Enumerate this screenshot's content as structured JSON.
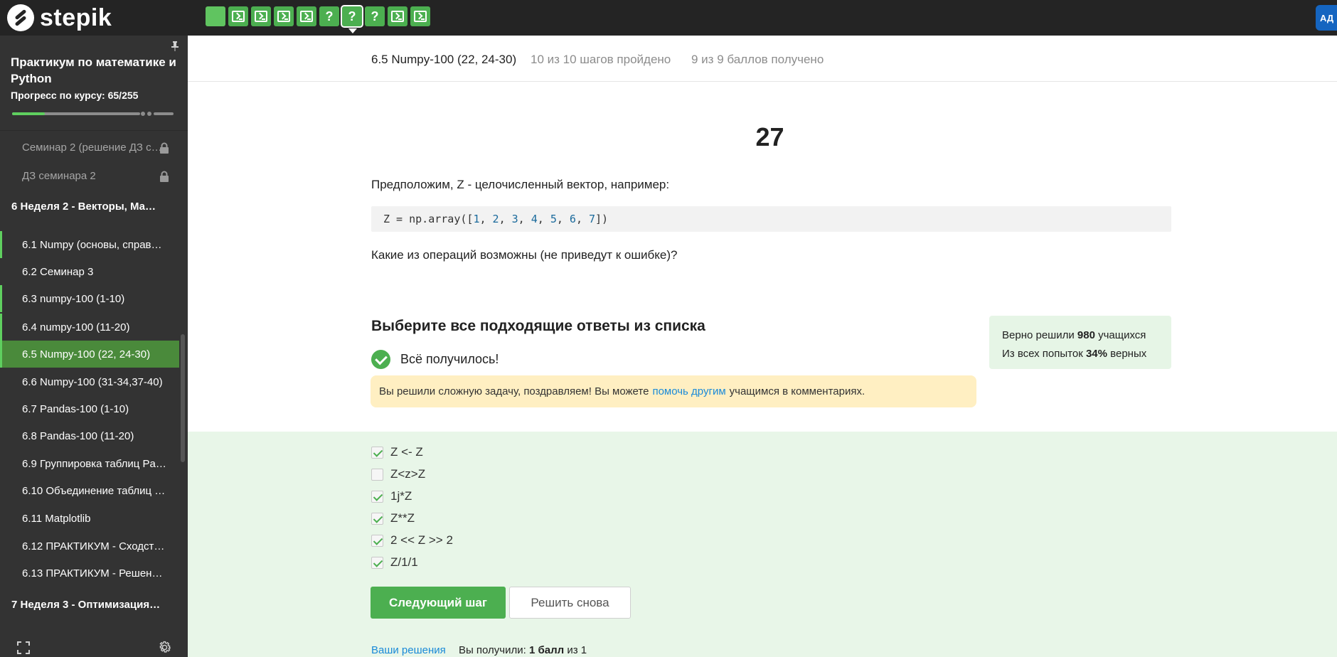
{
  "brand": {
    "name": "stepik"
  },
  "user": {
    "initials": "АД"
  },
  "step_nav": [
    {
      "kind": "empty"
    },
    {
      "kind": "code"
    },
    {
      "kind": "code"
    },
    {
      "kind": "code"
    },
    {
      "kind": "code"
    },
    {
      "kind": "quiz",
      "label": "?"
    },
    {
      "kind": "quiz",
      "label": "?",
      "current": true
    },
    {
      "kind": "quiz",
      "label": "?"
    },
    {
      "kind": "code"
    },
    {
      "kind": "code"
    }
  ],
  "sidebar": {
    "course_title": "Практикум по математике и Python",
    "progress_label": "Прогресс по курсу:  65/255",
    "progress_fraction": 0.255,
    "items": [
      {
        "type": "lesson",
        "label": "Семинар 2 (решение ДЗ с…",
        "state": "muted",
        "locked": true
      },
      {
        "type": "lesson",
        "label": "ДЗ семинара 2",
        "state": "muted",
        "locked": true
      },
      {
        "type": "module",
        "label": "6  Неделя 2 - Векторы, Ма…"
      },
      {
        "type": "lesson",
        "label": "6.1  Numpy (основы, справ…",
        "state": "done"
      },
      {
        "type": "lesson",
        "label": "6.2  Семинар 3",
        "state": "plain"
      },
      {
        "type": "lesson",
        "label": "6.3  numpy-100 (1-10)",
        "state": "done"
      },
      {
        "type": "lesson",
        "label": "6.4  numpy-100 (11-20)",
        "state": "done"
      },
      {
        "type": "lesson",
        "label": "6.5  Numpy-100 (22, 24-30)",
        "state": "active"
      },
      {
        "type": "lesson",
        "label": "6.6  Numpy-100 (31-34,37-40)",
        "state": "plain"
      },
      {
        "type": "lesson",
        "label": "6.7  Pandas-100 (1-10)",
        "state": "plain"
      },
      {
        "type": "lesson",
        "label": "6.8  Pandas-100 (11-20)",
        "state": "plain"
      },
      {
        "type": "lesson",
        "label": "6.9  Группировка таблиц Pa…",
        "state": "plain"
      },
      {
        "type": "lesson",
        "label": "6.10  Объединение таблиц …",
        "state": "plain"
      },
      {
        "type": "lesson",
        "label": "6.11  Matplotlib",
        "state": "plain"
      },
      {
        "type": "lesson",
        "label": "6.12  ПРАКТИКУМ - Сходст…",
        "state": "plain"
      },
      {
        "type": "lesson",
        "label": "6.13  ПРАКТИКУМ - Решени…",
        "state": "plain"
      },
      {
        "type": "module",
        "label": "7  Неделя 3 - Оптимизация…"
      }
    ]
  },
  "lesson_header": {
    "title": "6.5 Numpy-100 (22, 24-30)",
    "steps_status": "10 из 10 шагов пройдено",
    "score_status": "9 из 9 баллов  получено"
  },
  "step": {
    "number": "27",
    "prompt_1": "Предположим, Z - целочисленный вектор, например:",
    "code": {
      "prefix": "Z = np.array([",
      "numbers": [
        "1",
        "2",
        "3",
        "4",
        "5",
        "6",
        "7"
      ],
      "suffix": "])"
    },
    "prompt_2": "Какие из операций возможны (не приведут к ошибке)?"
  },
  "quiz": {
    "title": "Выберите все подходящие ответы из списка",
    "success_text": "Всё получилось!",
    "hint_before": "Вы решили сложную задачу, поздравляем! Вы можете",
    "hint_link": "помочь другим",
    "hint_after": "учащимся в комментариях.",
    "options": [
      {
        "label": "Z <- Z",
        "checked": true
      },
      {
        "label": "Z<z>Z",
        "checked": false
      },
      {
        "label": "1j*Z",
        "checked": true
      },
      {
        "label": "Z**Z",
        "checked": true
      },
      {
        "label": "2 << Z >> 2",
        "checked": true
      },
      {
        "label": "Z/1/1",
        "checked": true
      }
    ],
    "next_button": "Следующий шаг",
    "retry_button": "Решить снова"
  },
  "stats": {
    "solved_prefix": "Верно решили",
    "solved_count": "980",
    "solved_suffix": "учащихся",
    "attempts_prefix": "Из всех попыток",
    "attempts_percent": "34%",
    "attempts_suffix": "верных"
  },
  "footer": {
    "solutions_link": "Ваши решения",
    "received_prefix": "Вы получили:",
    "received_value": "1 балл",
    "received_suffix": "из 1"
  },
  "colors": {
    "accent_green": "#4caf50",
    "topbar": "#242424",
    "sidebar": "#333333",
    "hint_bg": "#ffefc2",
    "answers_bg": "#e8f6e8",
    "link": "#1a8ad8"
  }
}
